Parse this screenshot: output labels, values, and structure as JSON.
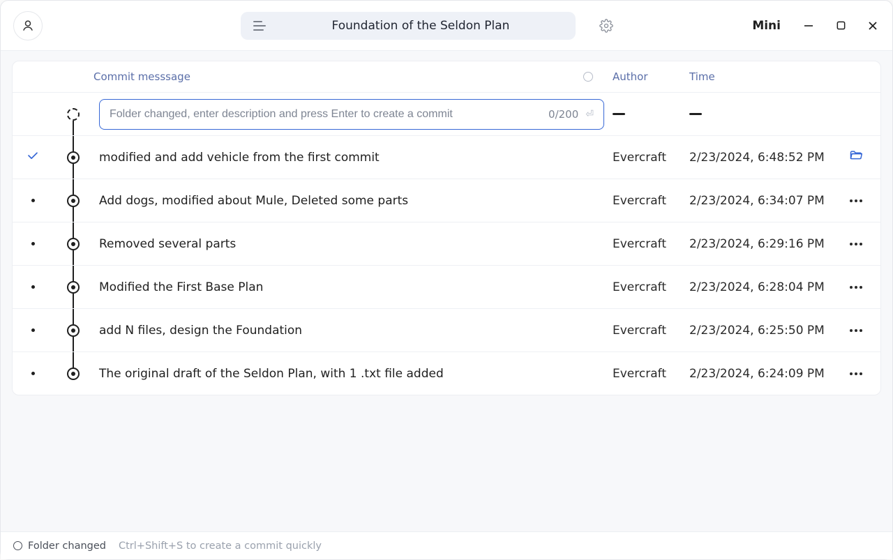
{
  "titlebar": {
    "project_name": "Foundation of the Seldon Plan",
    "mini_label": "Mini"
  },
  "columns": {
    "message": "Commit messsage",
    "author": "Author",
    "time": "Time"
  },
  "new_commit": {
    "placeholder": "Folder changed, enter description and press Enter to create a commit",
    "char_count": "0/200"
  },
  "commits": [
    {
      "message": "modified and add vehicle from the first commit",
      "author": "Evercraft",
      "time": "2/23/2024, 6:48:52 PM"
    },
    {
      "message": "Add dogs, modified about Mule, Deleted some parts",
      "author": "Evercraft",
      "time": "2/23/2024, 6:34:07 PM"
    },
    {
      "message": "Removed several parts",
      "author": "Evercraft",
      "time": "2/23/2024, 6:29:16 PM"
    },
    {
      "message": "Modified the First Base Plan",
      "author": "Evercraft",
      "time": "2/23/2024, 6:28:04 PM"
    },
    {
      "message": "add N files, design the Foundation",
      "author": "Evercraft",
      "time": "2/23/2024, 6:25:50 PM"
    },
    {
      "message": "The original draft of the Seldon Plan, with 1 .txt file added",
      "author": "Evercraft",
      "time": "2/23/2024, 6:24:09 PM"
    }
  ],
  "statusbar": {
    "state": "Folder changed",
    "hint": "Ctrl+Shift+S to create a commit quickly"
  }
}
